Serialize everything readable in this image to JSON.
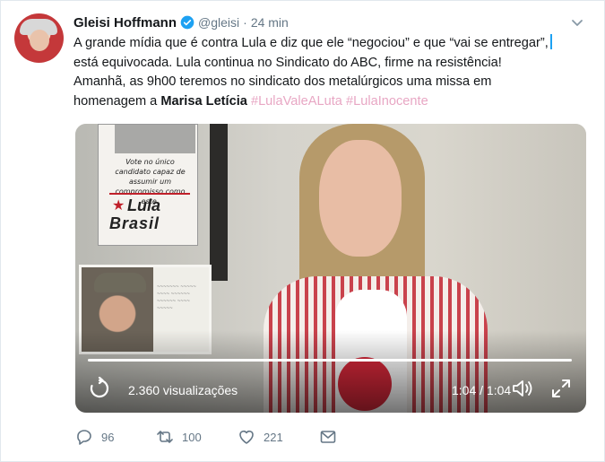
{
  "author": {
    "name": "Gleisi Hoffmann",
    "handle": "@gleisi",
    "separator": "·",
    "time": "24 min"
  },
  "tweet": {
    "line1": "A grande mídia que é contra Lula e diz que ele “negociou” e que “vai se entregar”,",
    "line2": "está equivocada. Lula continua no Sindicato do ABC, firme na resistência!",
    "line3": "Amanhã, as 9h00 teremos no sindicato dos metalúrgicos uma missa em",
    "line4_prefix": "homenagem a ",
    "line4_bold": "Marisa Letícia",
    "hashtag1": "#LulaValeALuta",
    "hashtag2": "#LulaInocente"
  },
  "video": {
    "poster_text": "Vote no único\ncandidato capaz de\nassumir um\ncompromisso como este.",
    "poster_lula": "Lula",
    "poster_brasil": "Brasil",
    "views": "2.360 visualizações",
    "duration": "1:04 / 1:04",
    "progress": 1.0
  },
  "actions": {
    "replies": "96",
    "retweets": "100",
    "likes": "221"
  },
  "colors": {
    "hashtag": "#e8a7c4",
    "secondary_text": "#657786",
    "verified": "#1da1f2"
  }
}
